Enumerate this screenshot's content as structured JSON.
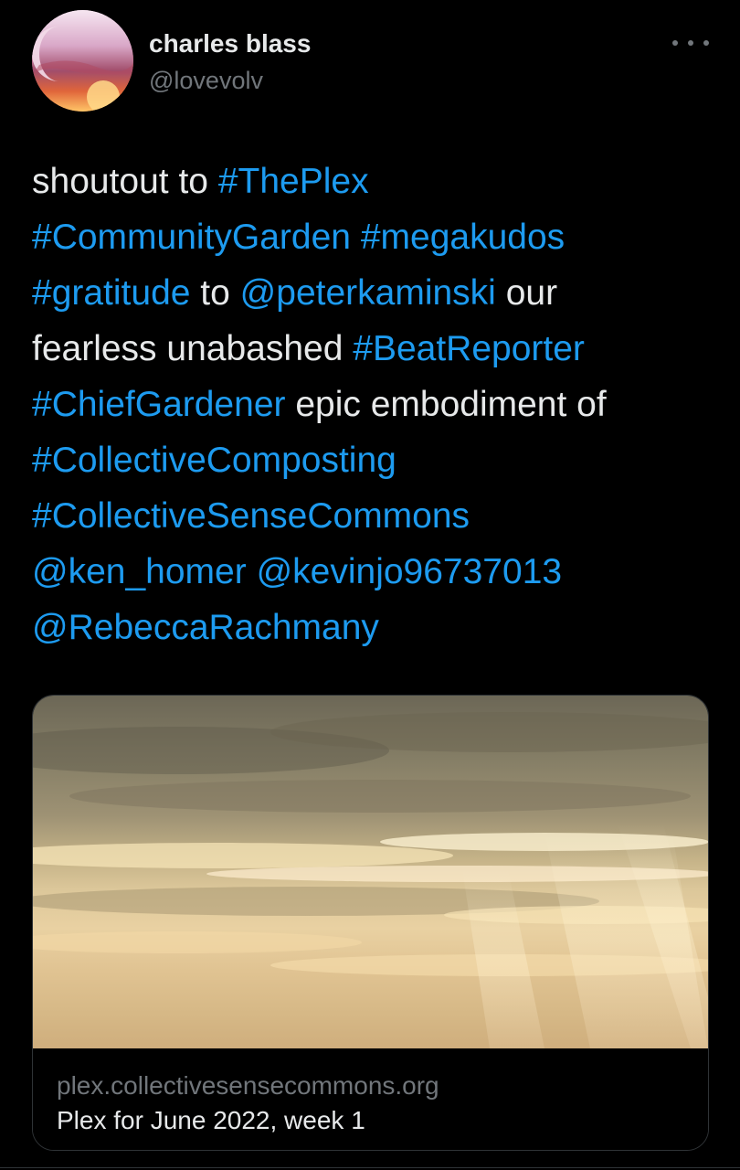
{
  "author": {
    "display_name": "charles blass",
    "handle": "@lovevolv"
  },
  "more_icon": "more-horizontal-icon",
  "tweet": {
    "lines": [
      [
        {
          "text": "shoutout to ",
          "link": false
        },
        {
          "text": "#ThePlex",
          "link": true
        }
      ],
      [
        {
          "text": "#CommunityGarden",
          "link": true
        },
        {
          "text": " ",
          "link": false
        },
        {
          "text": "#megakudos",
          "link": true
        }
      ],
      [
        {
          "text": "#gratitude",
          "link": true
        },
        {
          "text": " to ",
          "link": false
        },
        {
          "text": "@peterkaminski",
          "link": true
        },
        {
          "text": " our",
          "link": false
        }
      ],
      [
        {
          "text": "fearless unabashed ",
          "link": false
        },
        {
          "text": "#BeatReporter",
          "link": true
        }
      ],
      [
        {
          "text": "#ChiefGardener",
          "link": true
        },
        {
          "text": " epic embodiment of",
          "link": false
        }
      ],
      [
        {
          "text": "#CollectiveComposting",
          "link": true
        }
      ],
      [
        {
          "text": "#CollectiveSenseCommons",
          "link": true
        }
      ],
      [
        {
          "text": "@ken_homer",
          "link": true
        },
        {
          "text": " ",
          "link": false
        },
        {
          "text": "@kevinjo96737013",
          "link": true
        }
      ],
      [
        {
          "text": "@RebeccaRachmany",
          "link": true
        }
      ]
    ]
  },
  "card": {
    "domain": "plex.collectivesensecommons.org",
    "title": "Plex for June 2022, week 1"
  },
  "colors": {
    "background": "#000000",
    "text": "#e7e9ea",
    "secondary": "#71767b",
    "link": "#1d9bf0",
    "border": "#2f3336"
  }
}
